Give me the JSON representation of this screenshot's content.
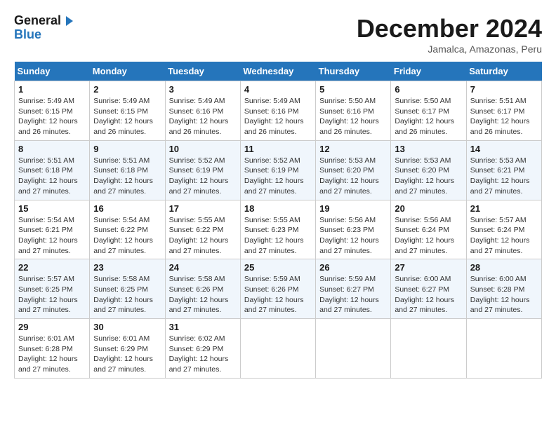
{
  "header": {
    "logo_line1": "General",
    "logo_line2": "Blue",
    "title": "December 2024",
    "location": "Jamalca, Amazonas, Peru"
  },
  "days_of_week": [
    "Sunday",
    "Monday",
    "Tuesday",
    "Wednesday",
    "Thursday",
    "Friday",
    "Saturday"
  ],
  "weeks": [
    [
      {
        "day": "1",
        "info": "Sunrise: 5:49 AM\nSunset: 6:15 PM\nDaylight: 12 hours\nand 26 minutes."
      },
      {
        "day": "2",
        "info": "Sunrise: 5:49 AM\nSunset: 6:15 PM\nDaylight: 12 hours\nand 26 minutes."
      },
      {
        "day": "3",
        "info": "Sunrise: 5:49 AM\nSunset: 6:16 PM\nDaylight: 12 hours\nand 26 minutes."
      },
      {
        "day": "4",
        "info": "Sunrise: 5:49 AM\nSunset: 6:16 PM\nDaylight: 12 hours\nand 26 minutes."
      },
      {
        "day": "5",
        "info": "Sunrise: 5:50 AM\nSunset: 6:16 PM\nDaylight: 12 hours\nand 26 minutes."
      },
      {
        "day": "6",
        "info": "Sunrise: 5:50 AM\nSunset: 6:17 PM\nDaylight: 12 hours\nand 26 minutes."
      },
      {
        "day": "7",
        "info": "Sunrise: 5:51 AM\nSunset: 6:17 PM\nDaylight: 12 hours\nand 26 minutes."
      }
    ],
    [
      {
        "day": "8",
        "info": "Sunrise: 5:51 AM\nSunset: 6:18 PM\nDaylight: 12 hours\nand 27 minutes."
      },
      {
        "day": "9",
        "info": "Sunrise: 5:51 AM\nSunset: 6:18 PM\nDaylight: 12 hours\nand 27 minutes."
      },
      {
        "day": "10",
        "info": "Sunrise: 5:52 AM\nSunset: 6:19 PM\nDaylight: 12 hours\nand 27 minutes."
      },
      {
        "day": "11",
        "info": "Sunrise: 5:52 AM\nSunset: 6:19 PM\nDaylight: 12 hours\nand 27 minutes."
      },
      {
        "day": "12",
        "info": "Sunrise: 5:53 AM\nSunset: 6:20 PM\nDaylight: 12 hours\nand 27 minutes."
      },
      {
        "day": "13",
        "info": "Sunrise: 5:53 AM\nSunset: 6:20 PM\nDaylight: 12 hours\nand 27 minutes."
      },
      {
        "day": "14",
        "info": "Sunrise: 5:53 AM\nSunset: 6:21 PM\nDaylight: 12 hours\nand 27 minutes."
      }
    ],
    [
      {
        "day": "15",
        "info": "Sunrise: 5:54 AM\nSunset: 6:21 PM\nDaylight: 12 hours\nand 27 minutes."
      },
      {
        "day": "16",
        "info": "Sunrise: 5:54 AM\nSunset: 6:22 PM\nDaylight: 12 hours\nand 27 minutes."
      },
      {
        "day": "17",
        "info": "Sunrise: 5:55 AM\nSunset: 6:22 PM\nDaylight: 12 hours\nand 27 minutes."
      },
      {
        "day": "18",
        "info": "Sunrise: 5:55 AM\nSunset: 6:23 PM\nDaylight: 12 hours\nand 27 minutes."
      },
      {
        "day": "19",
        "info": "Sunrise: 5:56 AM\nSunset: 6:23 PM\nDaylight: 12 hours\nand 27 minutes."
      },
      {
        "day": "20",
        "info": "Sunrise: 5:56 AM\nSunset: 6:24 PM\nDaylight: 12 hours\nand 27 minutes."
      },
      {
        "day": "21",
        "info": "Sunrise: 5:57 AM\nSunset: 6:24 PM\nDaylight: 12 hours\nand 27 minutes."
      }
    ],
    [
      {
        "day": "22",
        "info": "Sunrise: 5:57 AM\nSunset: 6:25 PM\nDaylight: 12 hours\nand 27 minutes."
      },
      {
        "day": "23",
        "info": "Sunrise: 5:58 AM\nSunset: 6:25 PM\nDaylight: 12 hours\nand 27 minutes."
      },
      {
        "day": "24",
        "info": "Sunrise: 5:58 AM\nSunset: 6:26 PM\nDaylight: 12 hours\nand 27 minutes."
      },
      {
        "day": "25",
        "info": "Sunrise: 5:59 AM\nSunset: 6:26 PM\nDaylight: 12 hours\nand 27 minutes."
      },
      {
        "day": "26",
        "info": "Sunrise: 5:59 AM\nSunset: 6:27 PM\nDaylight: 12 hours\nand 27 minutes."
      },
      {
        "day": "27",
        "info": "Sunrise: 6:00 AM\nSunset: 6:27 PM\nDaylight: 12 hours\nand 27 minutes."
      },
      {
        "day": "28",
        "info": "Sunrise: 6:00 AM\nSunset: 6:28 PM\nDaylight: 12 hours\nand 27 minutes."
      }
    ],
    [
      {
        "day": "29",
        "info": "Sunrise: 6:01 AM\nSunset: 6:28 PM\nDaylight: 12 hours\nand 27 minutes."
      },
      {
        "day": "30",
        "info": "Sunrise: 6:01 AM\nSunset: 6:29 PM\nDaylight: 12 hours\nand 27 minutes."
      },
      {
        "day": "31",
        "info": "Sunrise: 6:02 AM\nSunset: 6:29 PM\nDaylight: 12 hours\nand 27 minutes."
      },
      {
        "day": "",
        "info": ""
      },
      {
        "day": "",
        "info": ""
      },
      {
        "day": "",
        "info": ""
      },
      {
        "day": "",
        "info": ""
      }
    ]
  ]
}
